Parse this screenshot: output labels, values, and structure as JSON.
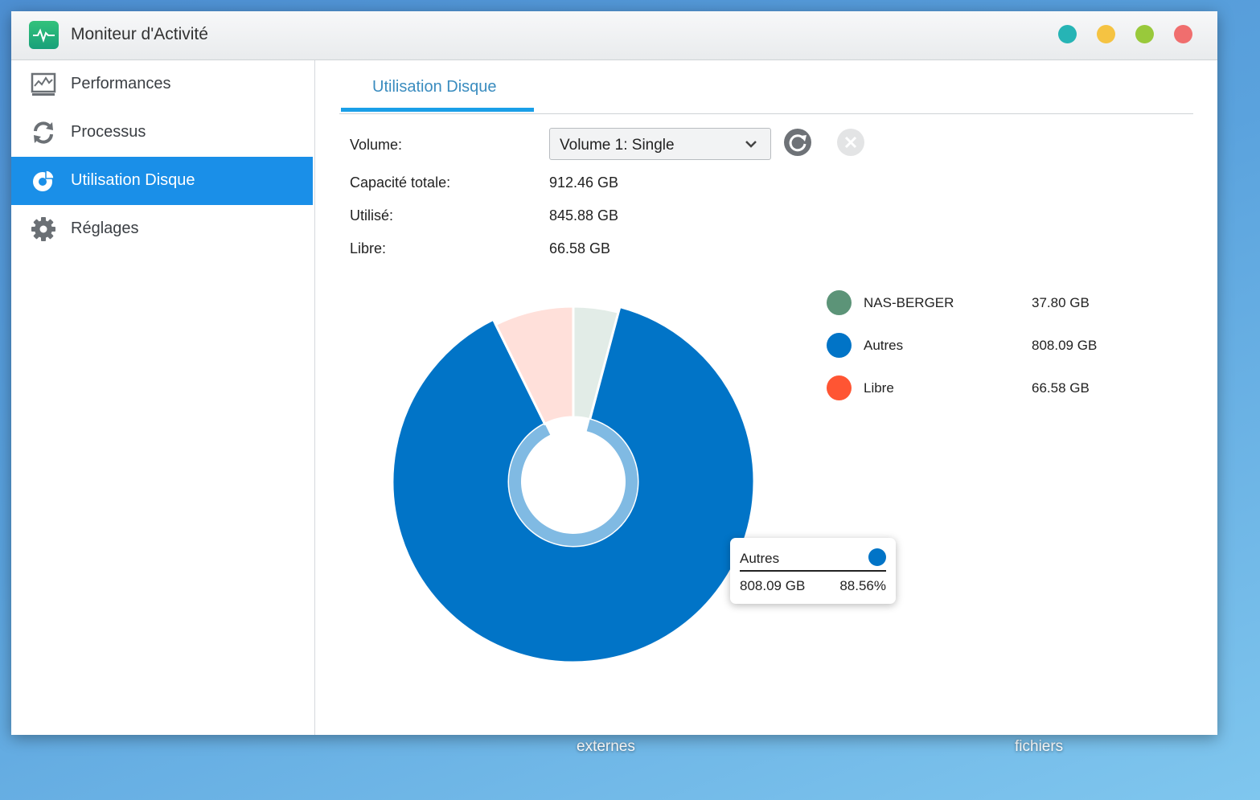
{
  "desktop": {
    "labels": [
      "externes",
      "fichiers"
    ]
  },
  "window": {
    "title": "Moniteur d'Activité",
    "controls": [
      {
        "name": "restore",
        "color": "#26b4b5"
      },
      {
        "name": "minimize",
        "color": "#f5c342"
      },
      {
        "name": "maximize",
        "color": "#99c93b"
      },
      {
        "name": "close",
        "color": "#f06e6e"
      }
    ]
  },
  "sidebar": {
    "items": [
      {
        "label": "Performances",
        "icon": "chart-monitor-icon",
        "active": false
      },
      {
        "label": "Processus",
        "icon": "refresh-cycle-icon",
        "active": false
      },
      {
        "label": "Utilisation Disque",
        "icon": "pie-disk-icon",
        "active": true
      },
      {
        "label": "Réglages",
        "icon": "gear-icon",
        "active": false
      }
    ]
  },
  "main": {
    "tab": "Utilisation Disque",
    "volume": {
      "label": "Volume:",
      "selected": "Volume 1: Single"
    },
    "stats": [
      {
        "label": "Capacité totale:",
        "value": "912.46 GB"
      },
      {
        "label": "Utilisé:",
        "value": "845.88 GB"
      },
      {
        "label": "Libre:",
        "value": "66.58 GB"
      }
    ],
    "tooltip": {
      "name": "Autres",
      "size": "808.09 GB",
      "percent": "88.56%"
    }
  },
  "chart_data": {
    "type": "pie",
    "unit": "GB",
    "categories": [
      "NAS-BERGER",
      "Autres",
      "Libre"
    ],
    "values": [
      37.8,
      808.09,
      66.58
    ],
    "labels": [
      "37.80 GB",
      "808.09 GB",
      "66.58 GB"
    ],
    "colors": [
      "#5c9478",
      "#0174c7",
      "#ff5533"
    ],
    "highlighted": "Autres"
  }
}
